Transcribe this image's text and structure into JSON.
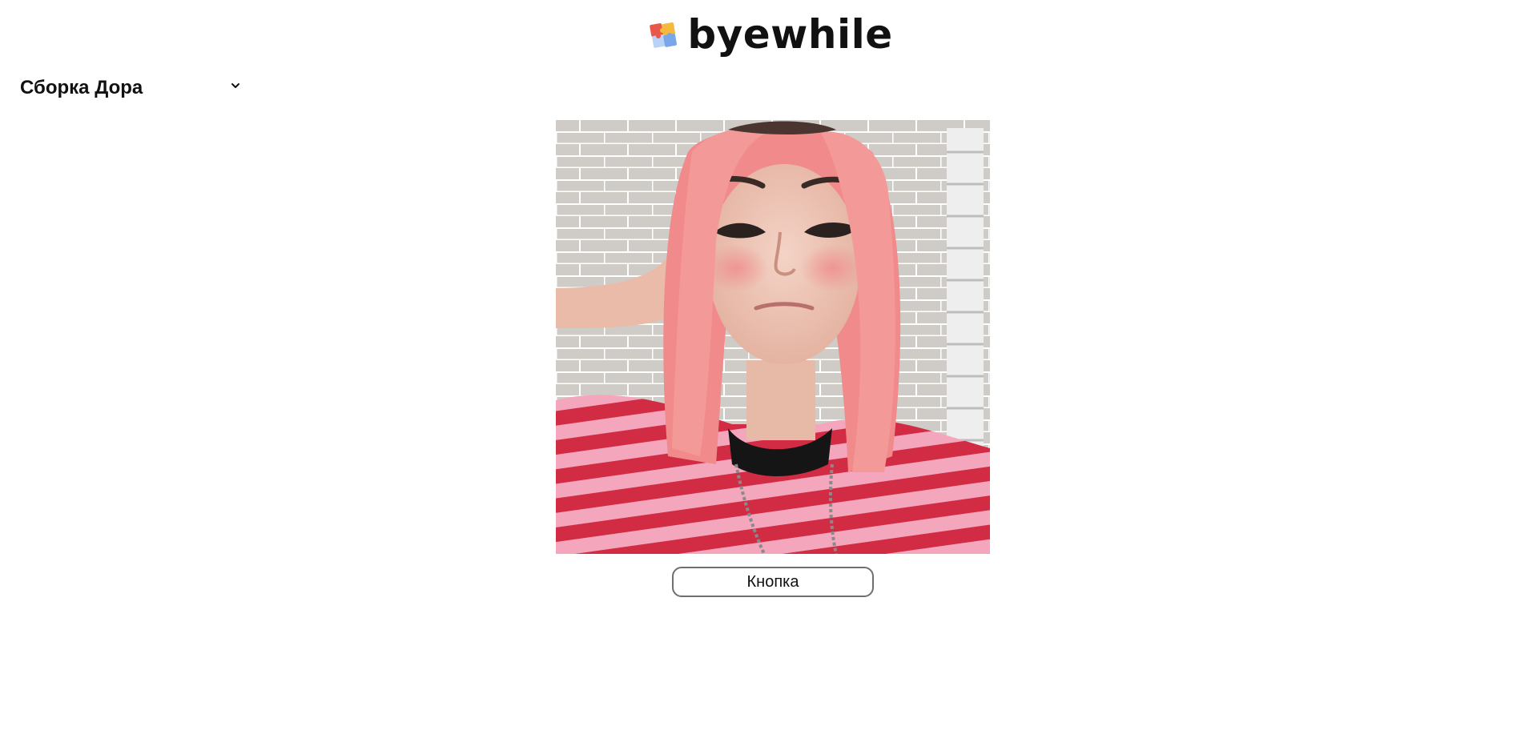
{
  "header": {
    "brand_name": "byewhile",
    "logo_icon": "puzzle-piece-icon"
  },
  "collection_selector": {
    "selected_value": "Сборка Дора",
    "icon": "chevron-down-icon"
  },
  "main": {
    "photo_icon": "portrait-photo",
    "button_label": "Кнопка"
  },
  "colors": {
    "background": "#ffffff",
    "text": "#111111",
    "button_border": "#6f6f6f",
    "puzzle_red": "#e8574a",
    "puzzle_yellow": "#f5b93b",
    "puzzle_blue": "#7aa7e8",
    "puzzle_lightblue": "#b9d3f7"
  }
}
